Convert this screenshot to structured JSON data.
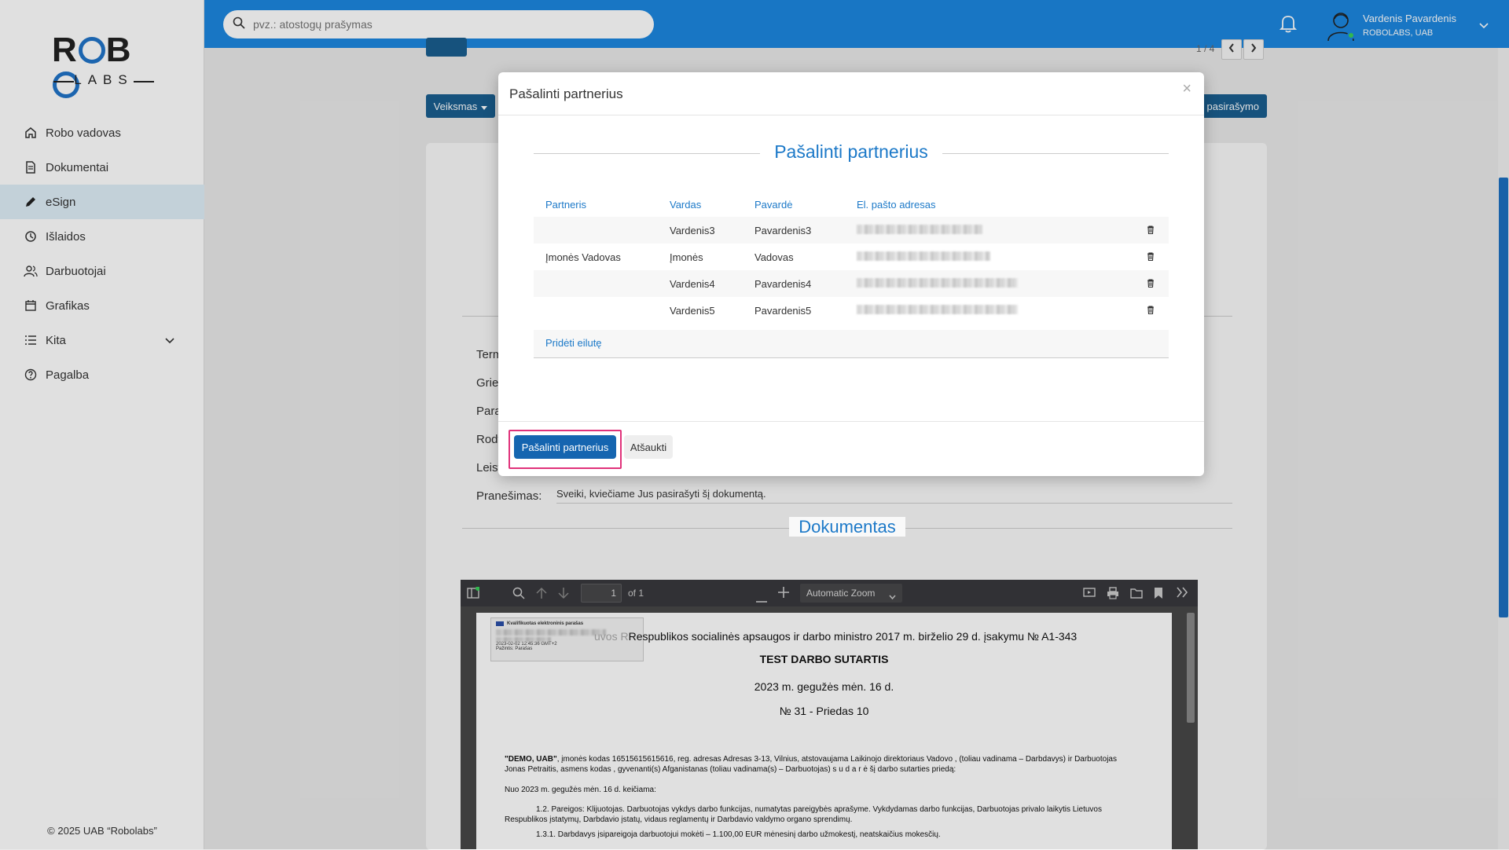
{
  "sidebar": {
    "logo_top": "ROBO",
    "logo_bottom": "LABS",
    "items": [
      {
        "label": "Robo vadovas",
        "icon": "home-icon"
      },
      {
        "label": "Dokumentai",
        "icon": "document-icon"
      },
      {
        "label": "eSign",
        "icon": "pen-icon",
        "active": true
      },
      {
        "label": "Išlaidos",
        "icon": "expenses-icon"
      },
      {
        "label": "Darbuotojai",
        "icon": "users-icon"
      },
      {
        "label": "Grafikas",
        "icon": "calendar-icon"
      },
      {
        "label": "Kita",
        "icon": "list-icon",
        "expandable": true
      },
      {
        "label": "Pagalba",
        "icon": "help-icon"
      }
    ],
    "copyright": "© 2025 UAB “Robolabs”"
  },
  "topbar": {
    "search_placeholder": "pvz.: atostogų prašymas",
    "user_name": "Vardenis Pavardenis",
    "user_company": "ROBOLABS, UAB",
    "accent": "#1c87e0"
  },
  "page": {
    "pager_text": "1 / 4",
    "action_button": "Veiksmas",
    "right_button": "pasirašymo",
    "field_labels": [
      "Term",
      "Griež",
      "Para",
      "Rody",
      "Leist"
    ],
    "message_label": "Pranešimas:",
    "message_value": "Sveiki, kviečiame Jus pasirašyti šį dokumentą.",
    "document_heading": "Dokumentas"
  },
  "pdf": {
    "page_number": "1",
    "page_of": "of 1",
    "zoom": "Automatic Zoom",
    "stamp_title": "Kvalifikuotas elektroninis parašas",
    "stamp_date": "2023-02-02 12:45:36 GMT+2",
    "stamp_reason": "Pažintis: Parašas",
    "line1": "Respublikos socialinės apsaugos ir darbo ministro 2017 m. birželio 29 d. įsakymu № A1-343",
    "line1_prefix": "uvos R",
    "title": "TEST DARBO SUTARTIS",
    "date": "2023 m. gegužės mėn. 16 d.",
    "number": "№ 31 - Priedas 10",
    "para1_bold": "\"DEMO, UAB\"",
    "para1_rest": ", įmonės kodas 16515615615616, reg. adresas Adresas 3-13, Vilnius, atstovaujama Laikinojo direktoriaus Vadovo , (toliau vadinama – Darbdavys) ir Darbuotojas Jonas Petraitis, asmens kodas , gyvenanti(s) Afganistanas (toliau vadinama(s) – Darbuotojas) s u d a r ė šį darbo sutarties priedą:",
    "para2": "Nuo 2023 m. gegužės mėn. 16 d. keičiama:",
    "para3": "1.2. Pareigos: Klijuotojas. Darbuotojas vykdys darbo funkcijas, numatytas pareigybės aprašyme. Vykdydamas darbo funkcijas, Darbuotojas privalo laikytis Lietuvos Respublikos įstatymų, Darbdavio įstatų, vidaus reglamentų ir Darbdavio valdymo organo sprendimų.",
    "para4": "1.3.1. Darbdavys įsipareigoja darbuotojui mokėti – 1.100,00 EUR mėnesinį darbo užmokestį, neatskaičius mokesčių."
  },
  "modal": {
    "title": "Pašalinti partnerius",
    "section_title": "Pašalinti partnerius",
    "columns": [
      "Partneris",
      "Vardas",
      "Pavardė",
      "El. pašto adresas"
    ],
    "rows": [
      {
        "partner": "",
        "name": "Vardenis3",
        "surname": "Pavardenis3"
      },
      {
        "partner": "Įmonės Vadovas",
        "name": "Įmonės",
        "surname": "Vadovas"
      },
      {
        "partner": "",
        "name": "Vardenis4",
        "surname": "Pavardenis4"
      },
      {
        "partner": "",
        "name": "Vardenis5",
        "surname": "Pavardenis5"
      }
    ],
    "add_row": "Pridėti eilutę",
    "confirm_button": "Pašalinti partnerius",
    "cancel_button": "Atšaukti",
    "close_symbol": "×"
  }
}
